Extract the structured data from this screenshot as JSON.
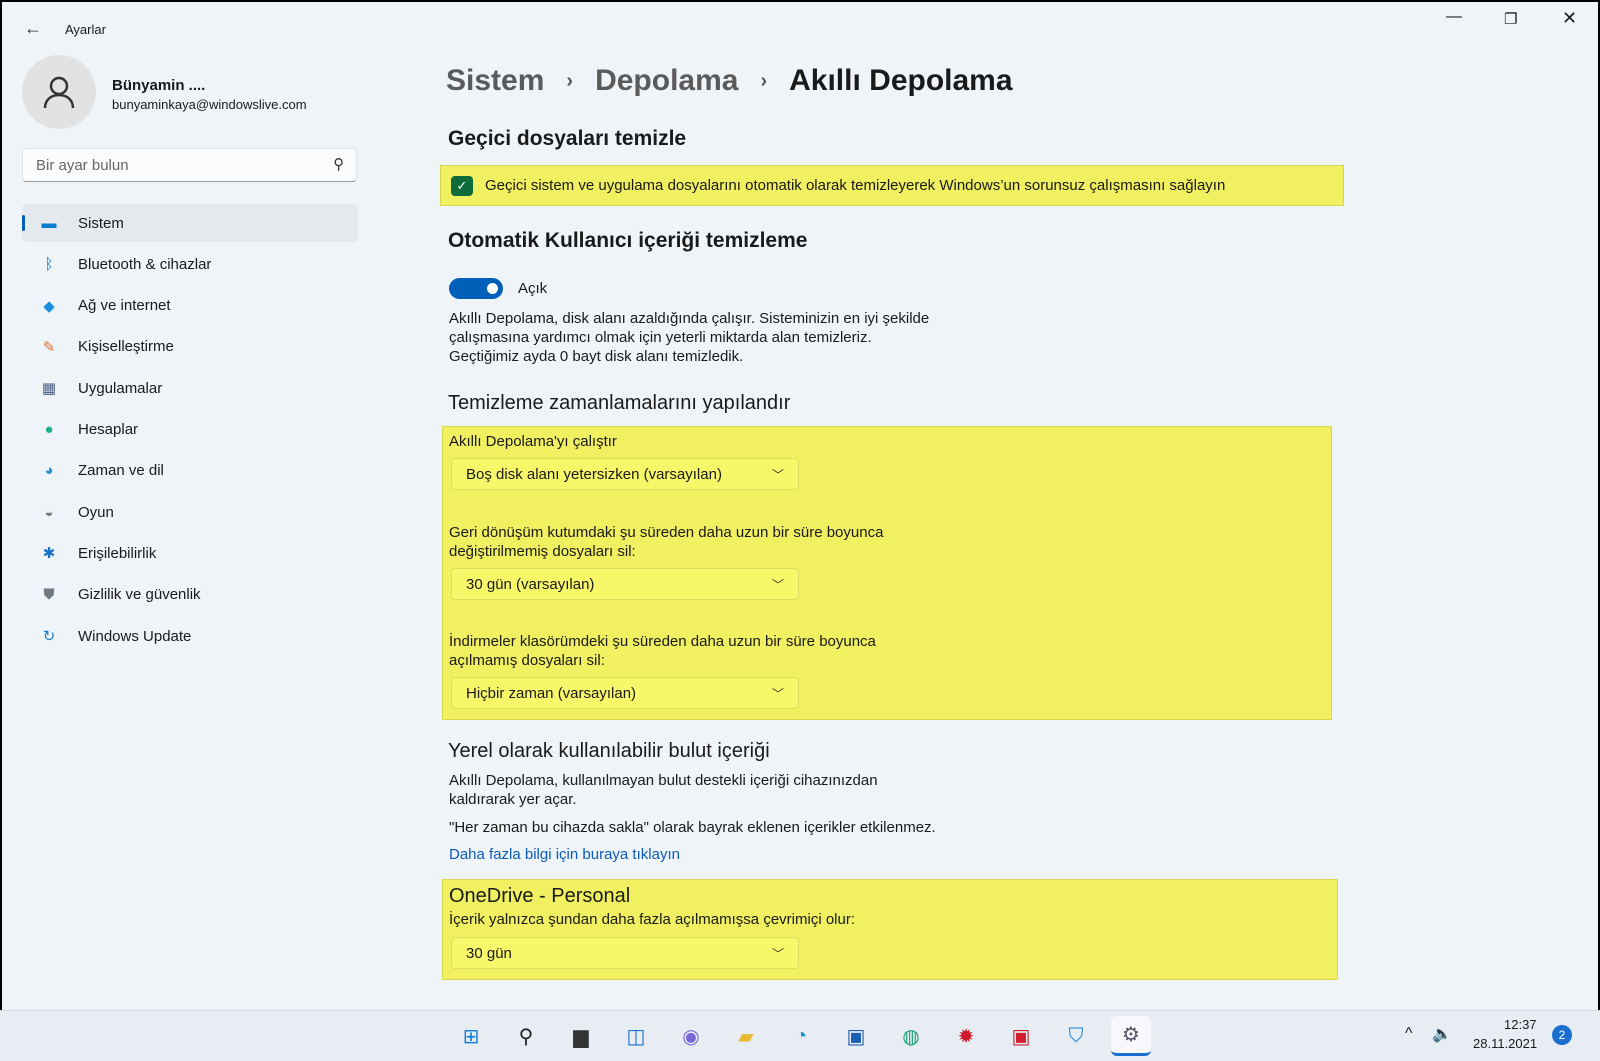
{
  "window": {
    "title": "Ayarlar",
    "back_icon": "arrow-left-icon",
    "controls": [
      "minimize",
      "restore",
      "close"
    ]
  },
  "user": {
    "name": "Bünyamin ....",
    "email": "bunyaminkaya@windowslive.com"
  },
  "search": {
    "placeholder": "Bir ayar bulun"
  },
  "sidebar": {
    "items": [
      {
        "label": "Sistem",
        "icon": "monitor-icon",
        "color": "#0a7fd0",
        "selected": true
      },
      {
        "label": "Bluetooth & cihazlar",
        "icon": "bluetooth-icon",
        "color": "#0078d4"
      },
      {
        "label": "Ağ ve internet",
        "icon": "wifi-icon",
        "color": "#1a8fe0"
      },
      {
        "label": "Kişiselleştirme",
        "icon": "brush-icon",
        "color": "#e07030"
      },
      {
        "label": "Uygulamalar",
        "icon": "apps-icon",
        "color": "#4a6080"
      },
      {
        "label": "Hesaplar",
        "icon": "person-icon",
        "color": "#1fb08a"
      },
      {
        "label": "Zaman ve dil",
        "icon": "globe-clock-icon",
        "color": "#2a90d0"
      },
      {
        "label": "Oyun",
        "icon": "gamepad-icon",
        "color": "#707880"
      },
      {
        "label": "Erişilebilirlik",
        "icon": "accessibility-icon",
        "color": "#1a70c8"
      },
      {
        "label": "Gizlilik ve güvenlik",
        "icon": "shield-icon",
        "color": "#707880"
      },
      {
        "label": "Windows Update",
        "icon": "update-icon",
        "color": "#1a80d0"
      }
    ]
  },
  "breadcrumb": [
    "Sistem",
    "Depolama",
    "Akıllı Depolama"
  ],
  "temp": {
    "heading": "Geçici dosyaları temizle",
    "checkbox_label": "Geçici sistem ve uygulama dosyalarını otomatik olarak temizleyerek Windows’un sorunsuz çalışmasını sağlayın",
    "checked": true
  },
  "auto": {
    "heading": "Otomatik Kullanıcı içeriği temizleme",
    "toggle_label": "Açık",
    "toggle_on": true,
    "desc": [
      "Akıllı Depolama, disk alanı azaldığında çalışır. Sisteminizin en iyi şekilde",
      "çalışmasına yardımcı olmak için yeterli miktarda alan temizleriz.",
      "Geçtiğimiz ayda 0 bayt disk alanı temizledik."
    ]
  },
  "schedule": {
    "heading": "Temizleme zamanlamalarını yapılandır",
    "run_label": "Akıllı Depolama'yı çalıştır",
    "run_value": "Boş disk alanı yetersizken (varsayılan)",
    "recycle_label": [
      "Geri dönüşüm kutumdaki şu süreden daha uzun bir süre boyunca",
      "değiştirilmemiş dosyaları sil:"
    ],
    "recycle_value": "30 gün (varsayılan)",
    "downloads_label": [
      "İndirmeler klasörümdeki şu süreden daha uzun bir süre boyunca",
      "açılmamış dosyaları sil:"
    ],
    "downloads_value": "Hiçbir zaman (varsayılan)"
  },
  "cloud": {
    "heading": "Yerel olarak kullanılabilir bulut içeriği",
    "desc": [
      "Akıllı Depolama, kullanılmayan bulut destekli içeriği cihazınızdan",
      "kaldırarak yer açar."
    ],
    "note": "\"Her zaman bu cihazda sakla\" olarak bayrak eklenen içerikler etkilenmez.",
    "link": "Daha fazla bilgi için buraya tıklayın"
  },
  "onedrive": {
    "heading": "OneDrive - Personal",
    "label": "İçerik yalnızca şundan daha fazla açılmamışsa çevrimiçi olur:",
    "value": "30 gün"
  },
  "taskbar": {
    "apps": [
      "start",
      "search",
      "task-view",
      "widgets",
      "chat",
      "file-explorer",
      "edge",
      "store",
      "app-green",
      "app-red",
      "app-recorder",
      "app-shield",
      "settings"
    ],
    "time": "12:37",
    "date": "28.11.2021",
    "notifications": "2"
  },
  "colors": {
    "accent": "#005fb8",
    "highlight": "#f0f060",
    "link": "#0a5cb8",
    "checkbox": "#0e6b3a"
  }
}
